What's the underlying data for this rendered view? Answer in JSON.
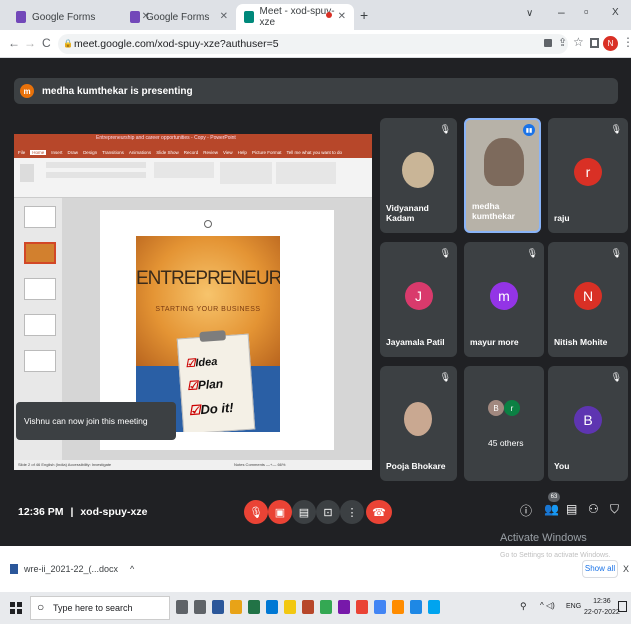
{
  "tabs": [
    {
      "label": "Google Forms",
      "color": "#7248b9"
    },
    {
      "label": "Google Forms",
      "color": "#7248b9"
    },
    {
      "label": "Meet - xod-spuy-xze",
      "color": "#00897b"
    }
  ],
  "new_tab_label": "+",
  "window_controls": {
    "dropdown": "∨",
    "minimize": "–",
    "restore": "▫",
    "close": "X"
  },
  "address": {
    "url": "meet.google.com/xod-spuy-xze?authuser=5",
    "profile_initial": "N"
  },
  "presenting": {
    "initial": "m",
    "text": "medha kumthekar is presenting"
  },
  "slide": {
    "app_title": "Entrepreneurship and career opportunities - Copy - PowerPoint",
    "ribbon_tabs": [
      "File",
      "Home",
      "Insert",
      "Draw",
      "Design",
      "Transitions",
      "Animations",
      "Slide Show",
      "Record",
      "Review",
      "View",
      "Help",
      "Picture Format"
    ],
    "tell_me": "Tell me what you want to do",
    "headline": "ENTREPRENEURSHIP",
    "subhead": "STARTING YOUR BUSINESS",
    "checklist": [
      "Idea",
      "Plan",
      "Do it!"
    ],
    "status_left": "Slide 2 of 46   English (India)   Accessibility: Investigate",
    "status_right": "Notes   Comments   —+—   66%",
    "toast": "Vishnu can now join this meeting"
  },
  "participants": [
    {
      "name": "Vidyanand Kadam",
      "initial": "",
      "type": "photo",
      "muted": true
    },
    {
      "name": "medha kumthekar",
      "initial": "",
      "type": "video",
      "muted": false
    },
    {
      "name": "raju",
      "initial": "r",
      "color": "#d93025",
      "muted": true
    },
    {
      "name": "Jayamala Patil",
      "initial": "J",
      "color": "#d93a6c",
      "muted": true
    },
    {
      "name": "mayur more",
      "initial": "m",
      "color": "#9334e6",
      "muted": true
    },
    {
      "name": "Nitish Mohite",
      "initial": "N",
      "color": "#d93025",
      "muted": true
    },
    {
      "name": "Pooja Bhokare",
      "initial": "",
      "type": "photo",
      "muted": true
    },
    {
      "name": "45 others",
      "initial": "",
      "type": "group",
      "muted": false
    },
    {
      "name": "You",
      "initial": "B",
      "color": "#5e35b1",
      "muted": true
    }
  ],
  "bottom": {
    "time": "12:36 PM",
    "meeting_code": "xod-spuy-xze",
    "separator": "|",
    "people_count": "63",
    "activate_title": "Activate Windows",
    "activate_sub": "Go to Settings to activate Windows."
  },
  "download": {
    "filename": "wre-ii_2021-22_(...docx",
    "chevron": "^",
    "show_all": "Show all",
    "close": "X"
  },
  "taskbar": {
    "search_placeholder": "Type here to search",
    "lang": "ENG",
    "clock_time": "12:36",
    "clock_date": "22-07-2022",
    "app_colors": [
      "#2b579a",
      "#e8a317",
      "#217346",
      "#0078d4",
      "#f2c811",
      "#b7472a",
      "#34a853",
      "#7719aa",
      "#ea4335",
      "#4285f4",
      "#ff8c00",
      "#1e88e5",
      "#00a4ef"
    ]
  }
}
